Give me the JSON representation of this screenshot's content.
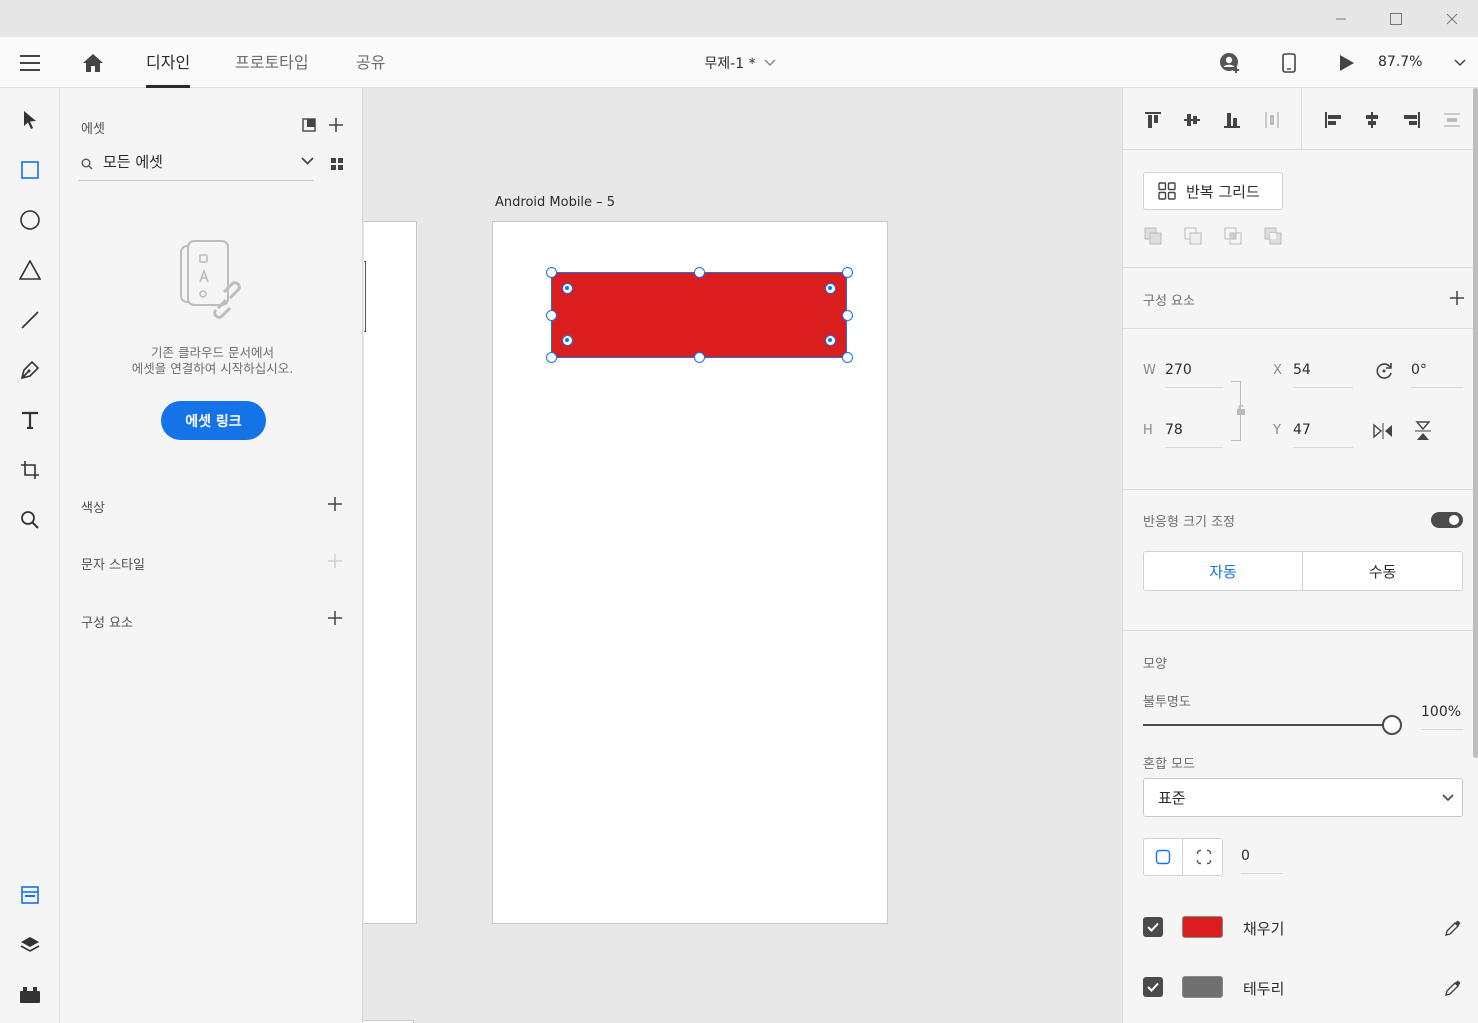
{
  "header": {
    "tabs": [
      {
        "label": "디자인"
      },
      {
        "label": "프로토타입"
      },
      {
        "label": "공유"
      }
    ],
    "document_title": "무제-1 *",
    "zoom": "87.7%"
  },
  "assets": {
    "title": "에셋",
    "search_value": "모든 에셋",
    "empty_line1": "기존 클라우드 문서에서",
    "empty_line2": "에셋을 연결하여 시작하십시오.",
    "link_button": "에셋 링크",
    "sections": [
      {
        "label": "색상"
      },
      {
        "label": "문자 스타일"
      },
      {
        "label": "구성 요소"
      }
    ]
  },
  "canvas": {
    "artboard_label": "Android Mobile – 5",
    "selected_fill": "#da1e1e",
    "selection_color": "#1473e6"
  },
  "props": {
    "repeat_grid": "반복 그리드",
    "components_label": "구성 요소",
    "w_label": "W",
    "w_value": "270",
    "h_label": "H",
    "h_value": "78",
    "x_label": "X",
    "x_value": "54",
    "y_label": "Y",
    "y_value": "47",
    "rotation_value": "0°",
    "responsive_label": "반응형 크기 조정",
    "responsive_on": true,
    "mode_auto": "자동",
    "mode_manual": "수동",
    "appearance_label": "모양",
    "opacity_label": "불투명도",
    "opacity_value": "100%",
    "opacity_fraction": 1.0,
    "blend_label": "혼합 모드",
    "blend_value": "표준",
    "corner_radius": "0",
    "fill_label": "채우기",
    "fill_color": "#da1e1e",
    "border_label": "테두리",
    "border_color": "#707070"
  }
}
